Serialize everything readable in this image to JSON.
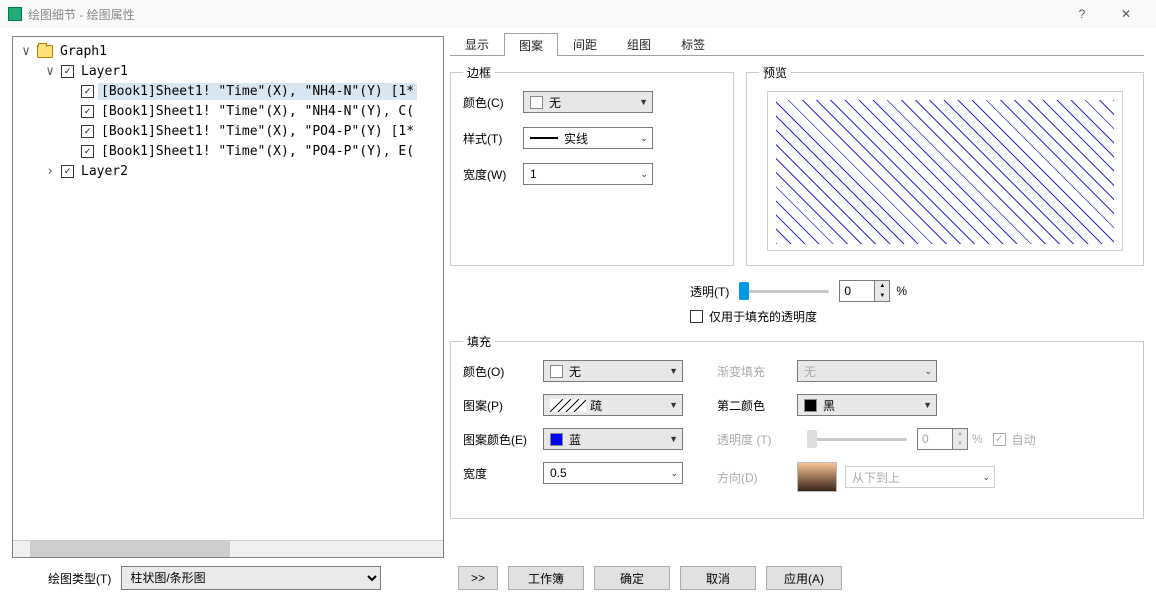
{
  "window": {
    "title": "绘图细节 - 绘图属性",
    "help": "?",
    "close": "✕"
  },
  "tree": {
    "graph": "Graph1",
    "layer1": "Layer1",
    "layer2": "Layer2",
    "items": [
      "[Book1]Sheet1! \"Time\"(X), \"NH4-N\"(Y) [1*",
      "[Book1]Sheet1! \"Time\"(X), \"NH4-N\"(Y), C(",
      "[Book1]Sheet1! \"Time\"(X), \"PO4-P\"(Y) [1*",
      "[Book1]Sheet1! \"Time\"(X), \"PO4-P\"(Y), E("
    ]
  },
  "tabs": {
    "display": "显示",
    "pattern": "图案",
    "spacing": "间距",
    "panel": "组图",
    "labels": "标签"
  },
  "border": {
    "legend": "边框",
    "color_label": "颜色(C)",
    "color_value": "无",
    "style_label": "样式(T)",
    "style_value": "实线",
    "width_label": "宽度(W)",
    "width_value": "1"
  },
  "preview": {
    "legend": "预览"
  },
  "transparency": {
    "label": "透明(T)",
    "value": "0",
    "percent": "%",
    "fill_only": "仅用于填充的透明度"
  },
  "fill": {
    "legend": "填充",
    "color_label": "颜色(O)",
    "color_value": "无",
    "pattern_label": "图案(P)",
    "pattern_value": "疏",
    "patcolor_label": "图案颜色(E)",
    "patcolor_value": "蓝",
    "width_label": "宽度",
    "width_value": "0.5",
    "gradient_label": "渐变填充",
    "gradient_value": "无",
    "color2_label": "第二颜色",
    "color2_value": "黑",
    "trans2_label": "透明度 (T)",
    "trans2_value": "0",
    "trans2_pct": "%",
    "auto_label": "自动",
    "direction_label": "方向(D)",
    "direction_value": "从下到上"
  },
  "footer": {
    "plot_type_label": "绘图类型(T)",
    "plot_type_value": "柱状图/条形图",
    "nav": ">>",
    "workbook": "工作簿",
    "ok": "确定",
    "cancel": "取消",
    "apply": "应用(A)"
  }
}
